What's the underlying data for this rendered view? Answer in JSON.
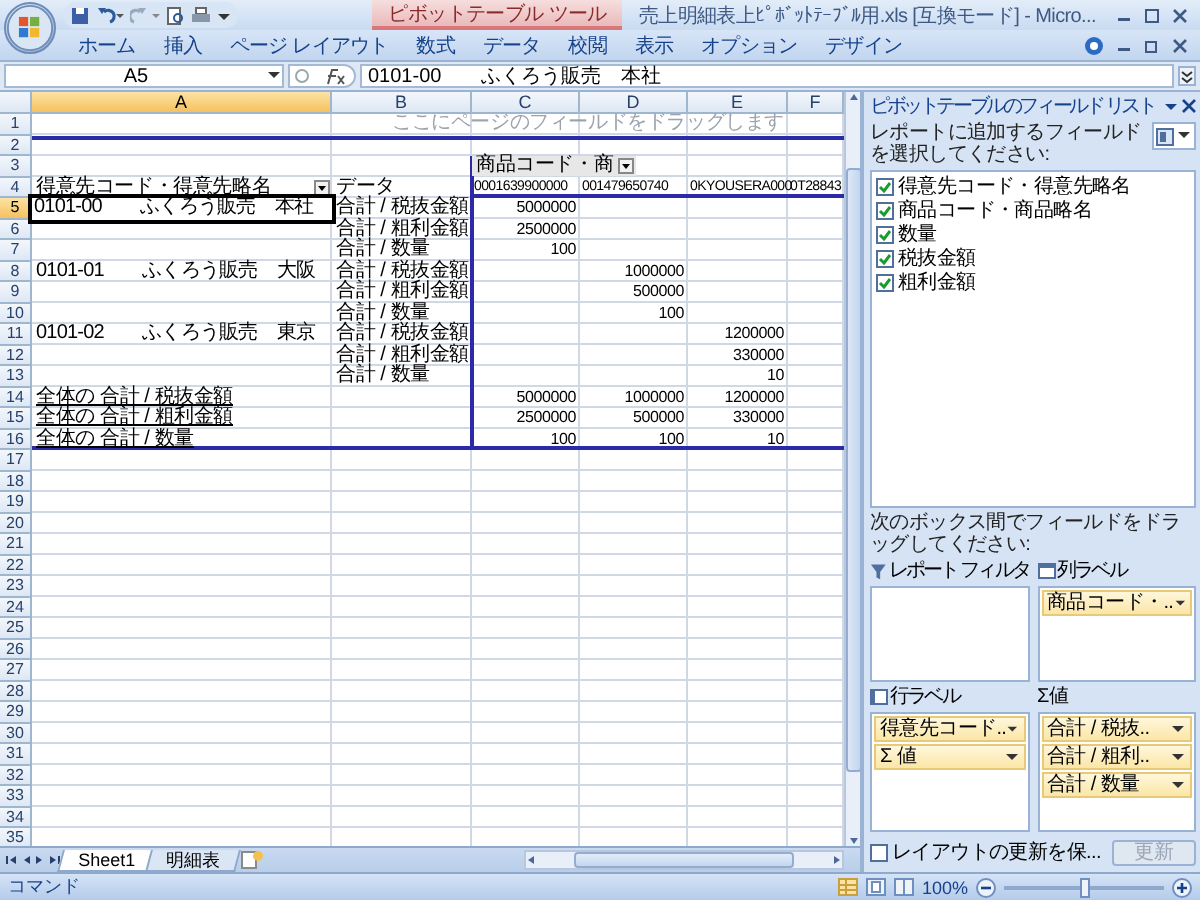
{
  "title_bar": {
    "context_tab": "ピボットテーブル ツール",
    "title": "売上明細表上ﾋﾟﾎﾞｯﾄﾃｰﾌﾞﾙ用.xls [互換モード] - Micro..."
  },
  "ribbon_tabs": [
    {
      "label": "ホーム",
      "selected": false
    },
    {
      "label": "挿入",
      "selected": false
    },
    {
      "label": "ページ レイアウト",
      "selected": false
    },
    {
      "label": "数式",
      "selected": false
    },
    {
      "label": "データ",
      "selected": false
    },
    {
      "label": "校閲",
      "selected": false
    },
    {
      "label": "表示",
      "selected": false
    },
    {
      "label": "オプション",
      "selected": false
    },
    {
      "label": "デザイン",
      "selected": false
    }
  ],
  "formula_bar": {
    "name_box": "A5",
    "formula": "0101-00　　ふくろう販売　本社"
  },
  "sheet": {
    "columns": [
      {
        "label": "A",
        "selected": true
      },
      {
        "label": "B",
        "selected": false
      },
      {
        "label": "C",
        "selected": false
      },
      {
        "label": "D",
        "selected": false
      },
      {
        "label": "E",
        "selected": false
      },
      {
        "label": "F",
        "selected": false
      }
    ],
    "rows": [
      {
        "number": "1",
        "selected": false,
        "page_hint": "ここにページのフィールドをドラッグします"
      },
      {
        "number": "2",
        "selected": false
      },
      {
        "number": "3",
        "selected": false,
        "column_field": "商品コード・商"
      },
      {
        "number": "4",
        "selected": false,
        "row_field": "得意先コード・得意先略名",
        "B": "データ",
        "C": "0001639900000",
        "D": "001479650740",
        "E": "0KYOUSERA000",
        "F": "0T28843"
      },
      {
        "number": "5",
        "selected": true,
        "A": "0101-00　　ふくろう販売　本社",
        "B": "合計 / 税抜金額",
        "C": "5000000"
      },
      {
        "number": "6",
        "selected": false,
        "B": "合計 / 粗利金額",
        "C": "2500000"
      },
      {
        "number": "7",
        "selected": false,
        "B": "合計 / 数量",
        "C": "100"
      },
      {
        "number": "8",
        "selected": false,
        "A": "0101-01　　ふくろう販売　大阪",
        "B": "合計 / 税抜金額",
        "D": "1000000"
      },
      {
        "number": "9",
        "selected": false,
        "B": "合計 / 粗利金額",
        "D": "500000"
      },
      {
        "number": "10",
        "selected": false,
        "B": "合計 / 数量",
        "D": "100"
      },
      {
        "number": "11",
        "selected": false,
        "A": "0101-02　　ふくろう販売　東京",
        "B": "合計 / 税抜金額",
        "E": "1200000"
      },
      {
        "number": "12",
        "selected": false,
        "B": "合計 / 粗利金額",
        "E": "330000"
      },
      {
        "number": "13",
        "selected": false,
        "B": "合計 / 数量",
        "E": "10"
      },
      {
        "number": "14",
        "selected": false,
        "grand_total": "全体の 合計 / 税抜金額",
        "C": "5000000",
        "D": "1000000",
        "E": "1200000"
      },
      {
        "number": "15",
        "selected": false,
        "grand_total": "全体の 合計 / 粗利金額",
        "C": "2500000",
        "D": "500000",
        "E": "330000"
      },
      {
        "number": "16",
        "selected": false,
        "grand_total": "全体の 合計 / 数量",
        "C": "100",
        "D": "100",
        "E": "10"
      },
      {
        "number": "17",
        "selected": false
      },
      {
        "number": "18",
        "selected": false
      },
      {
        "number": "19",
        "selected": false
      },
      {
        "number": "20",
        "selected": false
      },
      {
        "number": "21",
        "selected": false
      },
      {
        "number": "22",
        "selected": false
      },
      {
        "number": "23",
        "selected": false
      },
      {
        "number": "24",
        "selected": false
      },
      {
        "number": "25",
        "selected": false
      },
      {
        "number": "26",
        "selected": false
      },
      {
        "number": "27",
        "selected": false
      },
      {
        "number": "28",
        "selected": false
      },
      {
        "number": "29",
        "selected": false
      },
      {
        "number": "30",
        "selected": false
      },
      {
        "number": "31",
        "selected": false
      },
      {
        "number": "32",
        "selected": false
      },
      {
        "number": "33",
        "selected": false
      },
      {
        "number": "34",
        "selected": false
      },
      {
        "number": "35",
        "selected": false
      }
    ]
  },
  "sheet_tabs": [
    {
      "label": "Sheet1",
      "selected": true
    },
    {
      "label": "明細表",
      "selected": false
    }
  ],
  "status_bar": {
    "mode": "コマンド",
    "zoom": "100%",
    "zoom_slider": {
      "level": 0.5
    }
  },
  "field_list": {
    "title": "ピボットテーブルのフィールド リスト",
    "instruction": "レポートに追加するフィールドを選択してください:",
    "fields": [
      {
        "label": "得意先コード・得意先略名",
        "checked": true
      },
      {
        "label": "商品コード・商品略名",
        "checked": true
      },
      {
        "label": "数量",
        "checked": true
      },
      {
        "label": "税抜金額",
        "checked": true
      },
      {
        "label": "粗利金額",
        "checked": true
      }
    ],
    "drag_hint": "次のボックス間でフィールドをドラッグしてください:",
    "areas": [
      {
        "kind": "filter",
        "label": "レポート フィルタ"
      },
      {
        "kind": "columns",
        "label": "列ラベル",
        "items": [
          "商品コード・.."
        ]
      },
      {
        "kind": "rows",
        "label": "行ラベル",
        "items": [
          "得意先コード..",
          "Σ 値"
        ]
      },
      {
        "kind": "values",
        "label": "Σ 値",
        "items": [
          "合計 / 税抜..",
          "合計 / 粗利..",
          "合計 / 数量"
        ]
      }
    ],
    "defer_update": {
      "label": "レイアウトの更新を保...",
      "checked": false
    },
    "update_button": {
      "label": "更新",
      "disabled": true
    }
  }
}
